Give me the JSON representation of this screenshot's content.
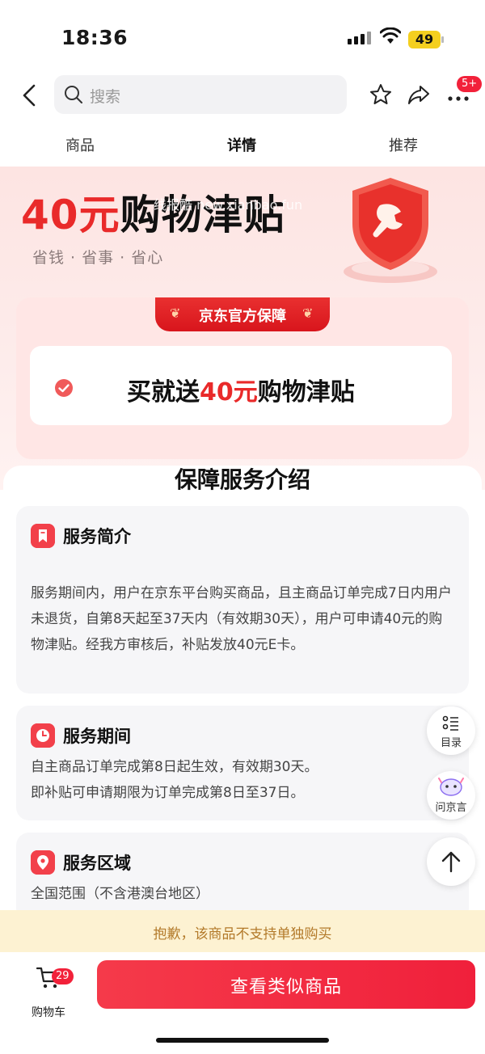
{
  "status_bar": {
    "time": "18:36",
    "battery": "49"
  },
  "nav": {
    "search_placeholder": "搜索",
    "more_badge": "5+"
  },
  "tabs": [
    {
      "label": "商品",
      "active": false
    },
    {
      "label": "详情",
      "active": true
    },
    {
      "label": "推荐",
      "active": false
    }
  ],
  "hero": {
    "title_amount": "40元",
    "title_rest": "购物津贴",
    "subtitle": "省钱 · 省事 · 省心",
    "watermark": "线报酷 new.xianbao.fun"
  },
  "guarantee": {
    "ribbon": "京东官方保障",
    "gift_prefix": "买就送",
    "gift_amount": "40元",
    "gift_suffix": "购物津贴"
  },
  "section_title": "保障服务介绍",
  "cards": [
    {
      "title": "服务简介",
      "body": "服务期间内，用户在京东平台购买商品，且主商品订单完成7日内用户未退货，自第8天起至37天内（有效期30天），用户可申请40元的购物津贴。经我方审核后，补贴发放40元E卡。"
    },
    {
      "title": "服务期间",
      "line1": "自主商品订单完成第8日起生效，有效期30天。",
      "line2": "即补贴可申请期限为订单完成第8日至37日。"
    },
    {
      "title": "服务区域",
      "body": "全国范围（不含港澳台地区）"
    }
  ],
  "float_buttons": {
    "toc": "目录",
    "ask": "问京言"
  },
  "notice": "抱歉，该商品不支持单独购买",
  "bottom": {
    "cart_label": "购物车",
    "cart_badge": "29",
    "primary": "查看类似商品"
  },
  "colors": {
    "brand_red": "#e92a2a",
    "button_red": "#f0203b",
    "notice_bg": "#fdf2d2"
  }
}
